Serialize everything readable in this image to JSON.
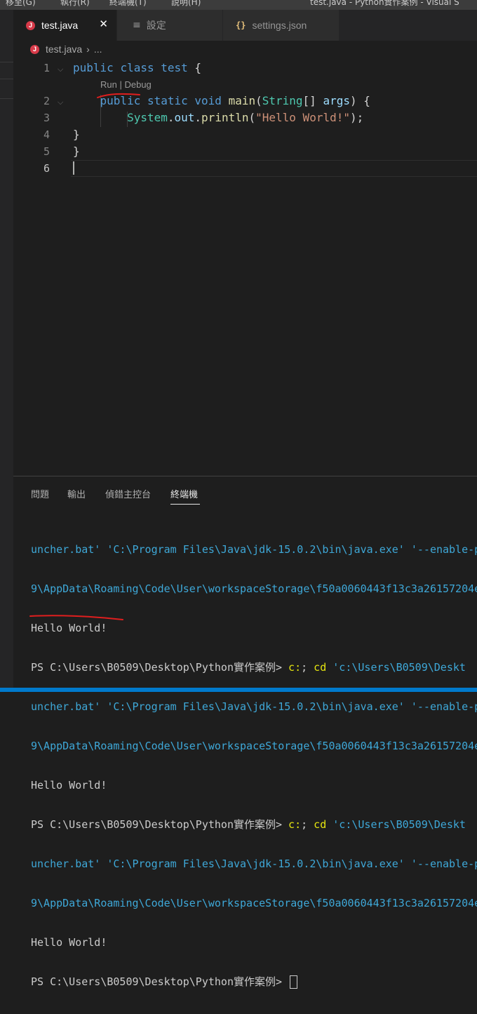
{
  "menubar": {
    "items": [
      "移至(G)",
      "執行(R)",
      "終端機(T)",
      "說明(H)"
    ],
    "window_title": "test.java - Python實作案例 - Visual S"
  },
  "tabs": [
    {
      "label": "test.java",
      "icon": "java-icon",
      "active": true
    },
    {
      "label": "設定",
      "icon": "settings-list-icon",
      "active": false
    },
    {
      "label": "settings.json",
      "icon": "json-braces-icon",
      "active": false
    }
  ],
  "tab_close_glyph": "✕",
  "breadcrumb": {
    "file": "test.java",
    "separator": "›",
    "more": "..."
  },
  "editor": {
    "line_numbers": [
      "1",
      "2",
      "3",
      "4",
      "5",
      "6"
    ],
    "codelens": {
      "run": "Run",
      "sep": " | ",
      "debug": "Debug"
    },
    "lines": {
      "l1": {
        "kw1": "public",
        "kw2": "class",
        "name": "test",
        "brace": "{"
      },
      "l2": {
        "kw1": "public",
        "kw2": "static",
        "kw3": "void",
        "method": "main",
        "open": "(",
        "type": "String",
        "arr": "[]",
        "param": "args",
        "close": ") {"
      },
      "l3": {
        "cls": "System",
        "dot1": ".",
        "field": "out",
        "dot2": ".",
        "method": "println",
        "open": "(",
        "str": "\"Hello World!\"",
        "close": ");"
      },
      "l4": {
        "text": "}"
      },
      "l5": {
        "text": "}"
      },
      "l6": {
        "text": ""
      }
    }
  },
  "panel": {
    "tabs": [
      "問題",
      "輸出",
      "偵錯主控台",
      "終端機"
    ],
    "active_tab": "終端機"
  },
  "terminal": {
    "launcher_line": "uncher.bat' 'C:\\Program Files\\Java\\jdk-15.0.2\\bin\\java.exe' '--enable-p",
    "storage_line": "9\\AppData\\Roaming\\Code\\User\\workspaceStorage\\f50a0060443f13c3a26157204e",
    "output": "Hello World!",
    "prompt": "PS C:\\Users\\B0509\\Desktop\\Python實作案例> ",
    "cmd_c": "c:",
    "cmd_semicolon": "; ",
    "cmd_cd": "cd",
    "cmd_path": " 'c:\\Users\\B0509\\Deskt"
  },
  "colors": {
    "accent": "#007acc",
    "annotation": "#e01e1e",
    "keyword": "#569cd6",
    "type": "#4ec9b0",
    "string": "#ce9178",
    "terminal_cyan": "#3ea8d8",
    "terminal_yellow": "#e5e510"
  }
}
